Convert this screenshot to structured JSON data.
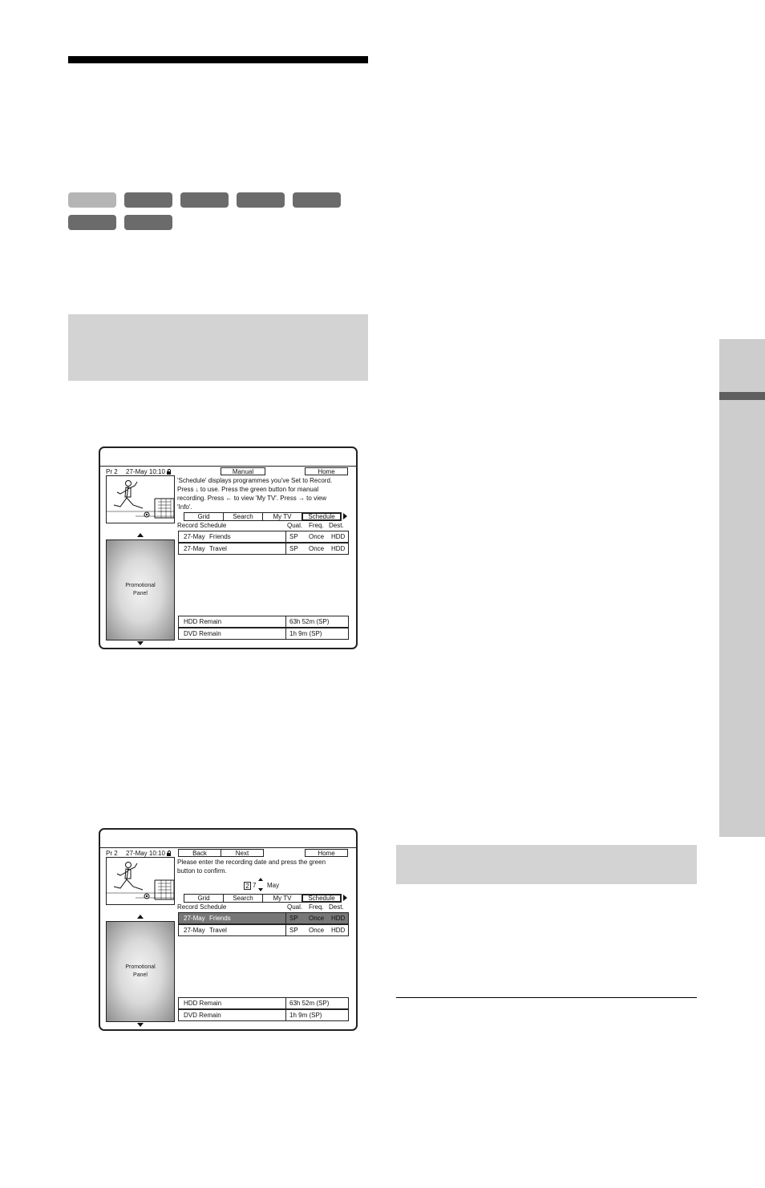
{
  "screens": [
    {
      "channel": "Pr 2",
      "datetime": "27-May 10:10",
      "buttons": [
        "Manual",
        "Home"
      ],
      "message": [
        "'Schedule' displays programmes you've Set to Record.",
        "Press ↓ to use. Press the green button for manual",
        "recording. Press ← to view 'My TV'. Press → to view",
        "'Info'."
      ],
      "tabs": [
        "Grid",
        "Search",
        "My TV",
        "Schedule"
      ],
      "list_title": "Record Schedule",
      "columns": [
        "Qual.",
        "Freq.",
        "Dest."
      ],
      "rows": [
        {
          "date": "27-May",
          "title": "Friends",
          "qual": "SP",
          "freq": "Once",
          "dest": "HDD"
        },
        {
          "date": "27-May",
          "title": "Travel",
          "qual": "SP",
          "freq": "Once",
          "dest": "HDD"
        }
      ],
      "promo": [
        "Promotional",
        "Panel"
      ],
      "remain": [
        {
          "label": "HDD Remain",
          "value": "63h 52m (SP)"
        },
        {
          "label": "DVD Remain",
          "value": "1h 9m (SP)"
        }
      ]
    },
    {
      "channel": "Pr 2",
      "datetime": "27-May 10:10",
      "buttons": [
        "Back",
        "Next",
        "Home"
      ],
      "message": [
        "Please enter the recording date and press the green",
        "button to confirm."
      ],
      "date_entry": {
        "digit1": "2",
        "digit2": "7",
        "month": "May"
      },
      "tabs": [
        "Grid",
        "Search",
        "My TV",
        "Schedule"
      ],
      "list_title": "Record Schedule",
      "columns": [
        "Qual.",
        "Freq.",
        "Dest."
      ],
      "rows": [
        {
          "date": "27-May",
          "title": "Friends",
          "qual": "SP",
          "freq": "Once",
          "dest": "HDD"
        },
        {
          "date": "27-May",
          "title": "Travel",
          "qual": "SP",
          "freq": "Once",
          "dest": "HDD"
        }
      ],
      "selected_row": 1,
      "promo": [
        "Promotional",
        "Panel"
      ],
      "remain": [
        {
          "label": "HDD Remain",
          "value": "63h 52m (SP)"
        },
        {
          "label": "DVD Remain",
          "value": "1h 9m (SP)"
        }
      ]
    }
  ],
  "colors": {
    "pill_dark": "#6b6b6b",
    "pill_light": "#b5b5b5",
    "panel_gray": "#d3d3d3",
    "side_tab": "#cdcdcd"
  }
}
